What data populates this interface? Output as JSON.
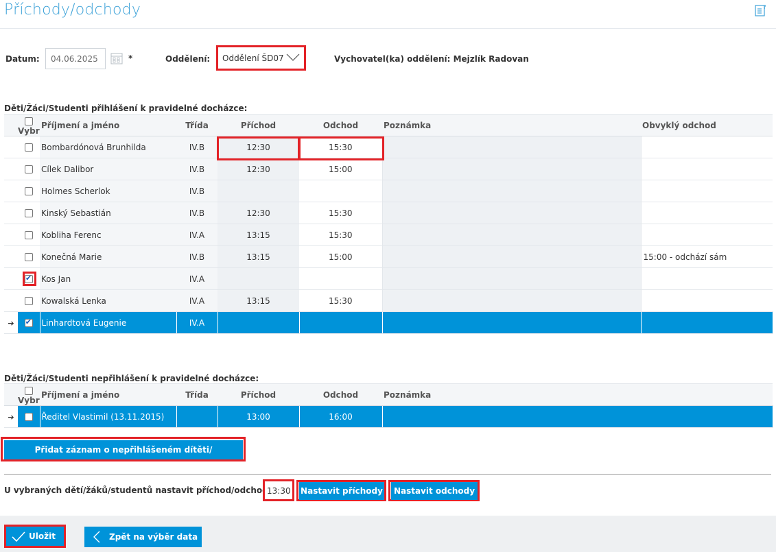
{
  "header": {
    "title": "Příchody/odchody"
  },
  "filters": {
    "date_label": "Datum:",
    "date_value": "04.06.2025",
    "required_mark": "*",
    "department_label": "Oddělení:",
    "department_value": "Oddělení ŠD07",
    "teacher_text": "Vychovatel(ka) oddělení: Mejzlík Radovan"
  },
  "registered": {
    "title": "Děti/Žáci/Studenti přihlášení k pravidelné docházce:",
    "columns": {
      "select": "Vybrat",
      "name": "Příjmení a jméno",
      "class": "Třída",
      "arrival": "Příchod",
      "departure": "Odchod",
      "note": "Poznámka",
      "usual": "Obvyklý odchod"
    },
    "rows": [
      {
        "name": "Bombardónová Brunhilda",
        "class": "IV.B",
        "arrival": "12:30",
        "departure": "15:30",
        "note": "",
        "usual": "",
        "checked": false
      },
      {
        "name": "Cílek Dalibor",
        "class": "IV.B",
        "arrival": "12:30",
        "departure": "15:00",
        "note": "",
        "usual": "",
        "checked": false
      },
      {
        "name": "Holmes Scherlok",
        "class": "IV.B",
        "arrival": "",
        "departure": "",
        "note": "",
        "usual": "",
        "checked": false
      },
      {
        "name": "Kinský Sebastián",
        "class": "IV.B",
        "arrival": "12:30",
        "departure": "15:30",
        "note": "",
        "usual": "",
        "checked": false
      },
      {
        "name": "Kobliha Ferenc",
        "class": "IV.A",
        "arrival": "13:15",
        "departure": "15:30",
        "note": "",
        "usual": "",
        "checked": false
      },
      {
        "name": "Konečná Marie",
        "class": "IV.B",
        "arrival": "13:15",
        "departure": "15:00",
        "note": "",
        "usual": "15:00 - odchází sám",
        "checked": false
      },
      {
        "name": "Kos Jan",
        "class": "IV.A",
        "arrival": "",
        "departure": "",
        "note": "",
        "usual": "",
        "checked": true
      },
      {
        "name": "Kowalská Lenka",
        "class": "IV.A",
        "arrival": "13:15",
        "departure": "15:30",
        "note": "",
        "usual": "",
        "checked": false
      },
      {
        "name": "Linhardtová Eugenie",
        "class": "IV.A",
        "arrival": "",
        "departure": "",
        "note": "",
        "usual": "",
        "checked": true
      }
    ]
  },
  "unregistered": {
    "title": "Děti/Žáci/Studenti nepřihlášení k pravidelné docházce:",
    "columns": {
      "select": "Vybrat",
      "name": "Příjmení a jméno",
      "class": "Třída",
      "arrival": "Příchod",
      "departure": "Odchod",
      "note": "Poznámka"
    },
    "rows": [
      {
        "name": "Ředitel Vlastimil (13.11.2015)",
        "class": "",
        "arrival": "13:00",
        "departure": "16:00",
        "note": "",
        "checked": false
      }
    ],
    "add_button": "Přidat záznam o nepřihlášeném dítěti/žákovi/studentovi"
  },
  "bulk": {
    "label": "U vybraných dětí/žáků/studentů nastavit příchod/odchod na:",
    "time_value": "13:30",
    "set_arrivals": "Nastavit příchody",
    "set_departures": "Nastavit odchody"
  },
  "footer": {
    "save": "Uložit",
    "back": "Zpět na výběr data"
  },
  "colors": {
    "accent": "#0093d9",
    "title": "#3da2d8",
    "highlight": "#e32227"
  }
}
